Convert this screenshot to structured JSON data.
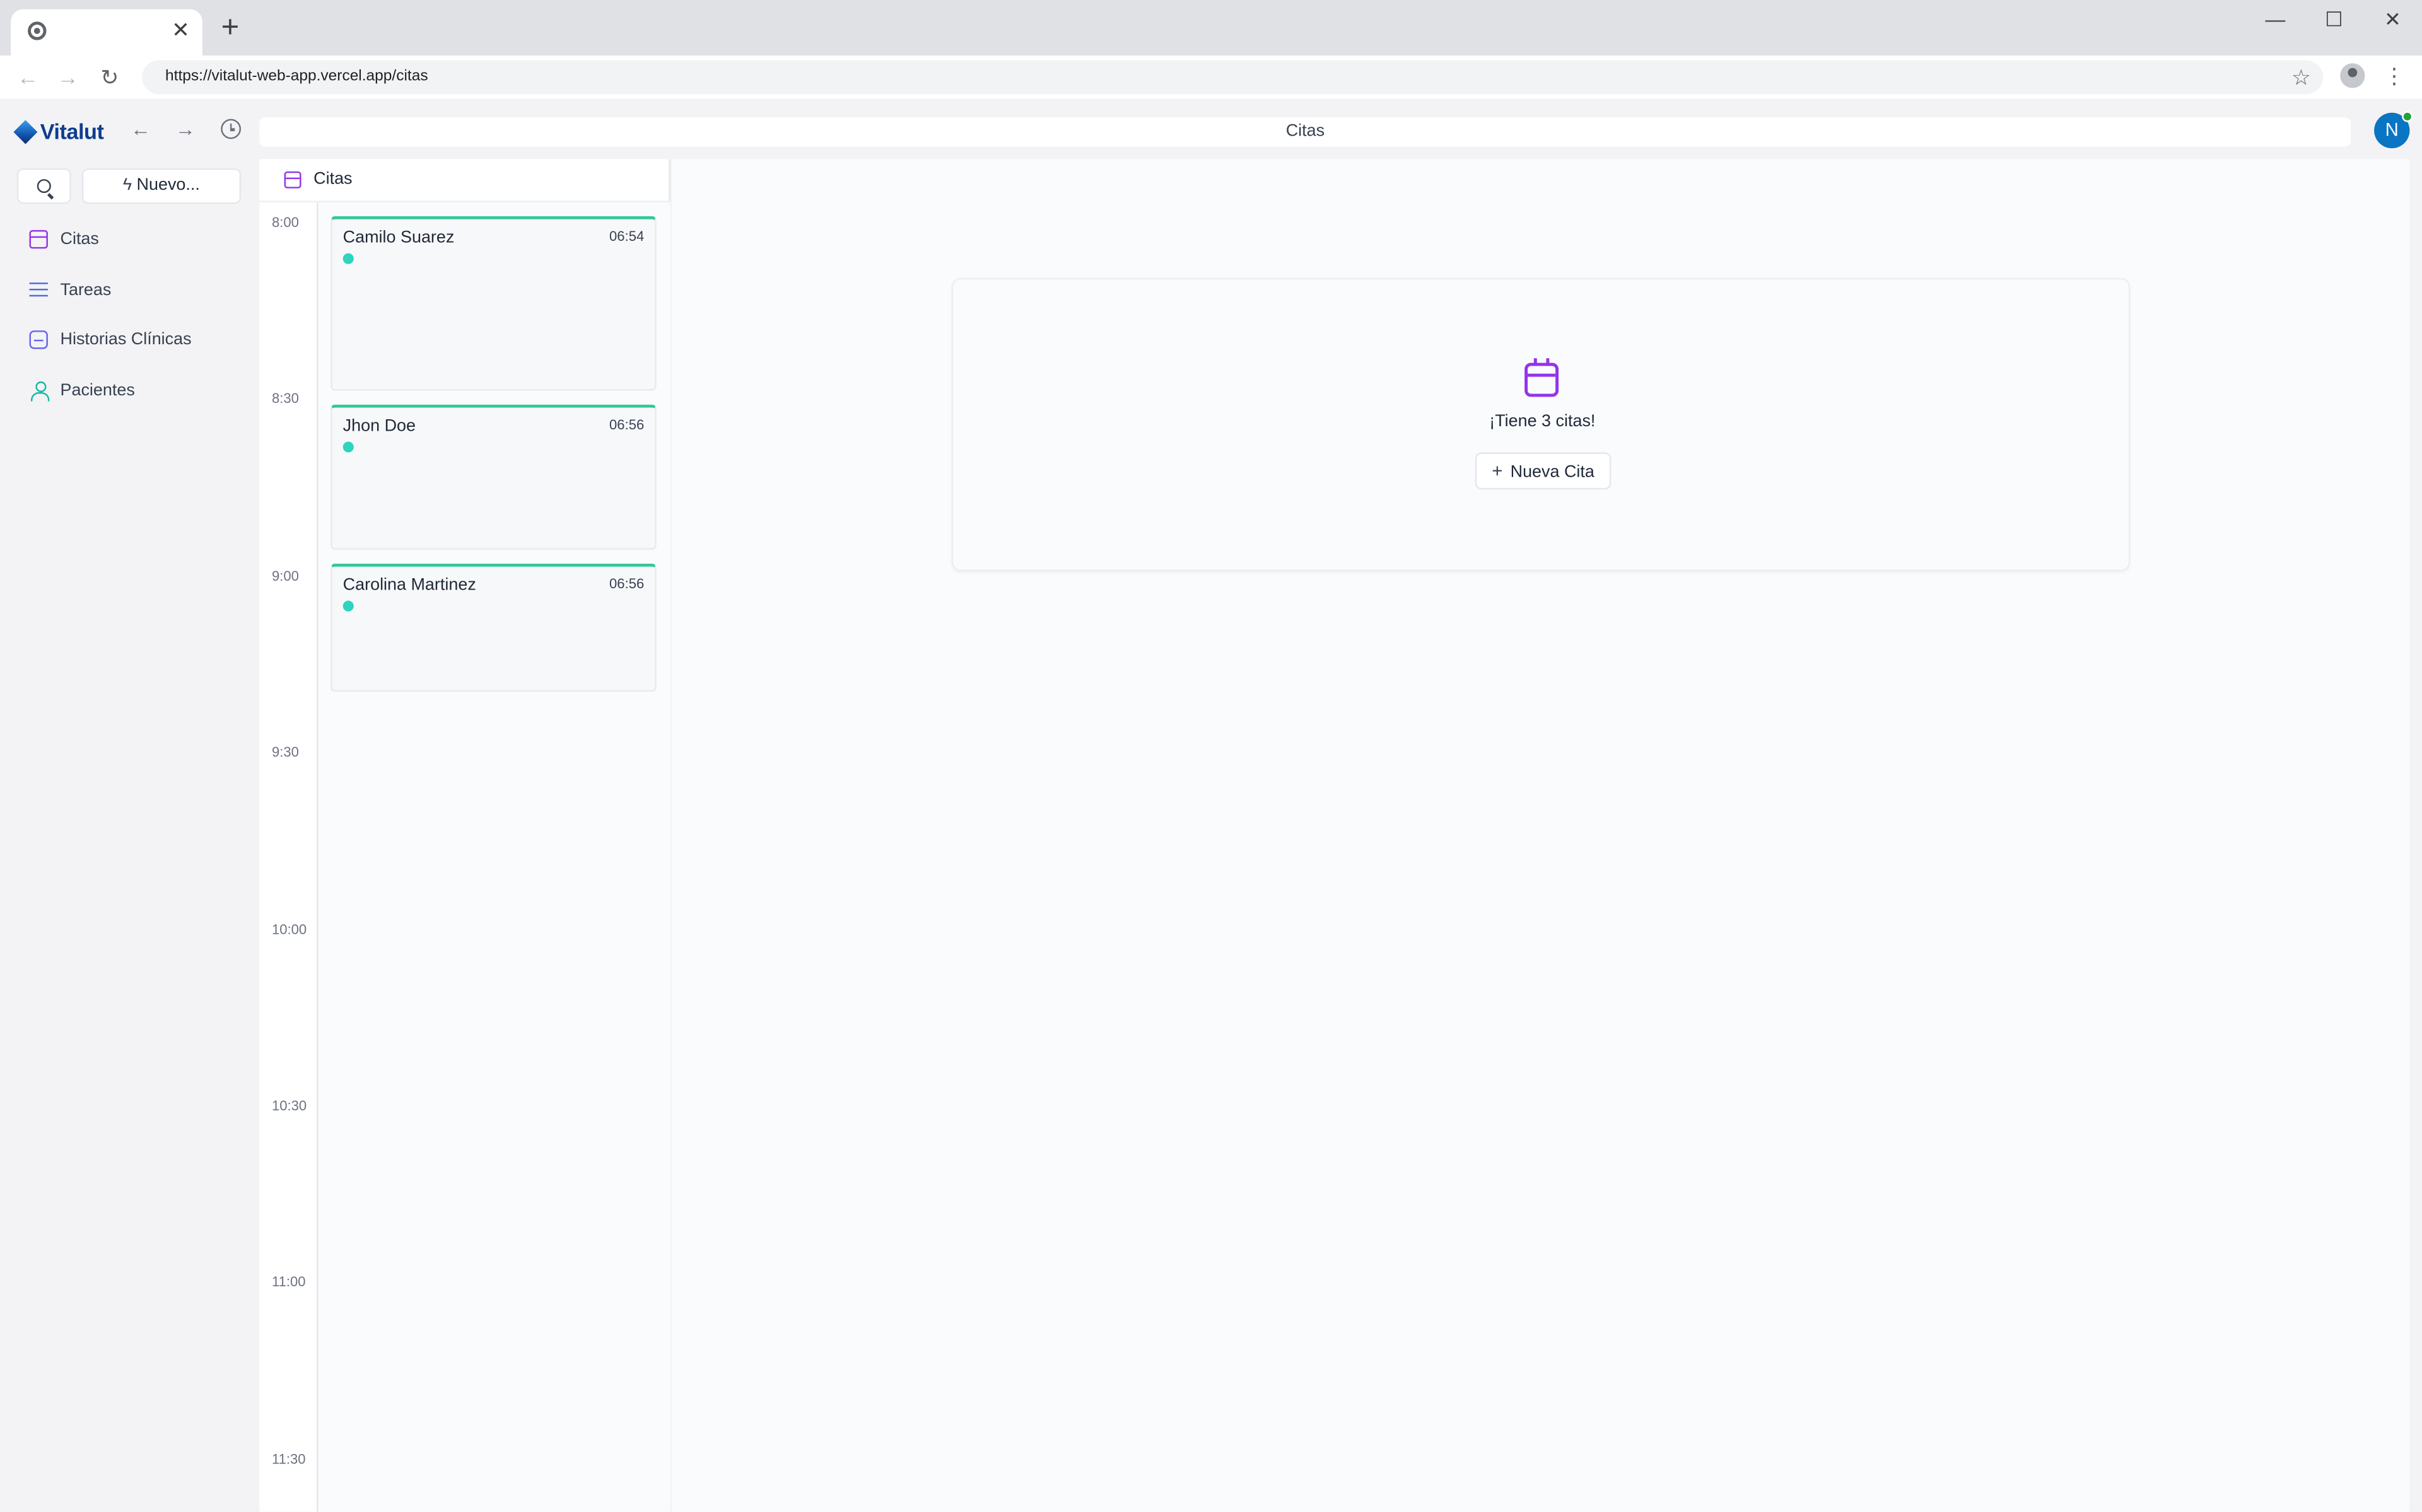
{
  "browser": {
    "tab_close": "✕",
    "new_tab": "+",
    "url": "https://vitalut-web-app.vercel.app/citas",
    "window_controls": {
      "minimize": "—",
      "maximize": "☐",
      "close": "✕"
    }
  },
  "app": {
    "logo": "Vitalut",
    "page_title": "Citas",
    "avatar_initial": "N",
    "new_button": "Nuevo..."
  },
  "sidebar": {
    "items": [
      {
        "label": "Citas",
        "icon": "calendar-icon"
      },
      {
        "label": "Tareas",
        "icon": "list-icon"
      },
      {
        "label": "Historias Clínicas",
        "icon": "inbox-icon"
      },
      {
        "label": "Pacientes",
        "icon": "user-icon"
      }
    ]
  },
  "calendar": {
    "title": "Citas",
    "time_slots": [
      "8:00",
      "8:30",
      "9:00",
      "9:30",
      "10:00",
      "10:30",
      "11:00",
      "11:30"
    ],
    "appointments": [
      {
        "name": "Camilo Suarez",
        "time": "06:54"
      },
      {
        "name": "Jhon Doe",
        "time": "06:56"
      },
      {
        "name": "Carolina Martinez",
        "time": "06:56"
      }
    ]
  },
  "main": {
    "empty_message": "¡Tiene 3 citas!",
    "new_appointment_button": "Nueva Cita"
  },
  "colors": {
    "accent_purple": "#9333ea",
    "event_top_border": "#34c79a",
    "event_dot": "#2dd4bf",
    "avatar_bg": "#0a75c2"
  }
}
